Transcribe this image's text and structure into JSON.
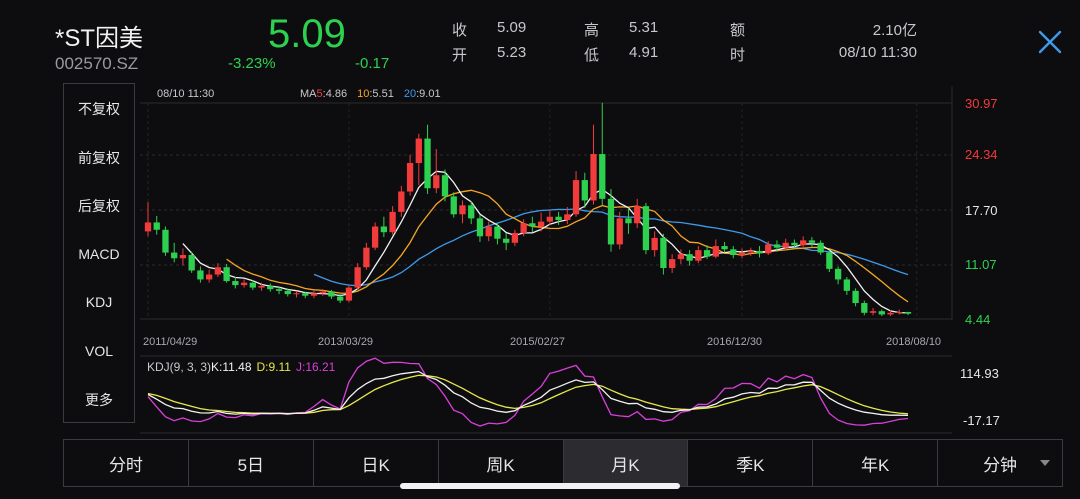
{
  "header": {
    "name": "*ST因美",
    "code": "002570.SZ",
    "price": "5.09",
    "change_pct": "-3.23%",
    "change_abs": "-0.17",
    "quotes": [
      {
        "label": "收",
        "value": "5.09"
      },
      {
        "label": "开",
        "value": "5.23"
      },
      {
        "label": "高",
        "value": "5.31"
      },
      {
        "label": "低",
        "value": "4.91"
      },
      {
        "label": "额",
        "value": "2.10亿"
      },
      {
        "label": "时",
        "value": "08/10 11:30"
      }
    ]
  },
  "side_menu": [
    {
      "label": "不复权",
      "active": false
    },
    {
      "label": "前复权",
      "active": true
    },
    {
      "label": "后复权",
      "active": false
    },
    {
      "label": "MACD",
      "active": false
    },
    {
      "label": "KDJ",
      "active": true
    },
    {
      "label": "VOL",
      "active": false
    },
    {
      "label": "更多",
      "active": false
    }
  ],
  "tabs": [
    {
      "label": "分时"
    },
    {
      "label": "5日"
    },
    {
      "label": "日K"
    },
    {
      "label": "周K"
    },
    {
      "label": "月K"
    },
    {
      "label": "季K"
    },
    {
      "label": "年K"
    },
    {
      "label": "分钟"
    }
  ],
  "active_tab": "月K",
  "colors": {
    "up": "#f23b3b",
    "down": "#2ed14f",
    "ma5": "#f2f2f2",
    "ma10": "#f5a623",
    "ma20": "#3f9ae8",
    "k": "#f2f2f2",
    "d": "#e8e84a",
    "j": "#d93fd9",
    "accent": "#3f9ae8"
  },
  "chart_data": {
    "type": "candlestick",
    "period": "monthly",
    "date_label": "08/10 11:30",
    "ma_legend": {
      "prefix": "MA",
      "ma5_label": "5",
      "ma5_value": "4.86",
      "ma10_label": "10",
      "ma10_value": "5.51",
      "ma20_label": "20",
      "ma20_value": "9.01"
    },
    "price_ticks": [
      "30.97",
      "24.34",
      "17.70",
      "11.07",
      "4.44"
    ],
    "price_tick_values": [
      30.97,
      24.34,
      17.7,
      11.07,
      4.44
    ],
    "x_ticks": [
      "2011/04/29",
      "2013/03/29",
      "2015/02/27",
      "2016/12/30",
      "2018/08/10"
    ],
    "x_tick_index": [
      0,
      23,
      46,
      68,
      88
    ],
    "candles": [
      [
        15.2,
        16.3,
        18.8,
        14.6
      ],
      [
        16.3,
        15.4,
        17.1,
        14.8
      ],
      [
        15.4,
        12.6,
        15.8,
        12.2
      ],
      [
        12.6,
        11.9,
        13.8,
        11.4
      ],
      [
        11.9,
        12.3,
        13.1,
        11.0
      ],
      [
        12.3,
        10.4,
        12.7,
        10.1
      ],
      [
        10.4,
        9.3,
        10.9,
        8.9
      ],
      [
        9.3,
        9.9,
        10.5,
        8.9
      ],
      [
        9.9,
        10.8,
        11.3,
        9.6
      ],
      [
        10.8,
        9.1,
        11.2,
        8.9
      ],
      [
        9.1,
        8.6,
        9.6,
        8.2
      ],
      [
        8.6,
        8.9,
        9.3,
        8.3
      ],
      [
        8.9,
        8.3,
        9.2,
        8.0
      ],
      [
        8.3,
        8.5,
        8.9,
        7.9
      ],
      [
        8.5,
        8.1,
        8.8,
        7.8
      ],
      [
        8.1,
        7.9,
        8.4,
        7.5
      ],
      [
        7.9,
        7.5,
        8.2,
        7.2
      ],
      [
        7.5,
        7.6,
        7.9,
        7.1
      ],
      [
        7.6,
        7.3,
        7.8,
        7.0
      ],
      [
        7.3,
        7.6,
        7.9,
        7.0
      ],
      [
        7.6,
        7.8,
        8.1,
        7.3
      ],
      [
        7.8,
        7.2,
        8.0,
        6.9
      ],
      [
        7.2,
        6.7,
        7.5,
        6.4
      ],
      [
        6.7,
        8.3,
        8.6,
        6.5
      ],
      [
        8.3,
        10.8,
        11.3,
        8.1
      ],
      [
        10.8,
        13.2,
        13.8,
        10.5
      ],
      [
        13.2,
        15.8,
        16.3,
        12.9
      ],
      [
        15.8,
        15.1,
        17.0,
        14.5
      ],
      [
        15.1,
        17.6,
        18.3,
        14.8
      ],
      [
        17.6,
        20.1,
        20.8,
        17.0
      ],
      [
        20.1,
        23.6,
        24.6,
        19.6
      ],
      [
        23.6,
        26.6,
        27.2,
        20.9
      ],
      [
        26.6,
        20.5,
        28.3,
        19.8
      ],
      [
        20.5,
        22.1,
        25.3,
        19.9
      ],
      [
        22.1,
        19.5,
        22.8,
        18.9
      ],
      [
        19.5,
        17.3,
        20.0,
        16.9
      ],
      [
        17.3,
        18.4,
        19.0,
        16.2
      ],
      [
        18.4,
        16.8,
        18.9,
        16.1
      ],
      [
        16.8,
        14.6,
        17.2,
        13.9
      ],
      [
        14.6,
        15.8,
        16.4,
        14.0
      ],
      [
        15.8,
        14.3,
        16.2,
        13.6
      ],
      [
        14.3,
        13.8,
        15.0,
        12.9
      ],
      [
        13.8,
        15.0,
        15.4,
        13.4
      ],
      [
        15.0,
        16.2,
        16.7,
        14.6
      ],
      [
        16.2,
        15.8,
        17.0,
        15.1
      ],
      [
        15.8,
        16.4,
        17.5,
        15.2
      ],
      [
        16.4,
        17.0,
        17.8,
        16.0
      ],
      [
        17.0,
        16.6,
        17.6,
        16.0
      ],
      [
        16.6,
        17.3,
        18.2,
        16.1
      ],
      [
        17.3,
        21.5,
        22.6,
        17.0
      ],
      [
        21.5,
        19.0,
        22.4,
        18.1
      ],
      [
        19.0,
        24.7,
        28.3,
        18.5
      ],
      [
        24.7,
        19.2,
        31.0,
        18.4
      ],
      [
        19.2,
        13.6,
        20.4,
        12.7
      ],
      [
        13.6,
        16.8,
        17.6,
        13.0
      ],
      [
        16.8,
        16.2,
        18.1,
        14.9
      ],
      [
        16.2,
        18.3,
        19.2,
        15.6
      ],
      [
        18.3,
        12.9,
        18.7,
        12.4
      ],
      [
        12.9,
        14.4,
        15.2,
        12.1
      ],
      [
        14.4,
        10.7,
        14.9,
        9.9
      ],
      [
        10.7,
        11.8,
        12.4,
        10.1
      ],
      [
        11.8,
        12.4,
        13.0,
        11.2
      ],
      [
        12.4,
        11.6,
        12.9,
        11.0
      ],
      [
        11.6,
        12.9,
        13.4,
        11.3
      ],
      [
        12.9,
        12.1,
        13.5,
        11.8
      ],
      [
        12.1,
        13.4,
        14.2,
        11.9
      ],
      [
        13.4,
        13.0,
        13.9,
        12.6
      ],
      [
        13.0,
        12.3,
        13.4,
        11.9
      ],
      [
        12.3,
        12.6,
        13.1,
        11.9
      ],
      [
        12.6,
        12.8,
        13.2,
        12.2
      ],
      [
        12.8,
        12.5,
        13.4,
        12.0
      ],
      [
        12.5,
        13.6,
        14.0,
        12.3
      ],
      [
        13.6,
        13.2,
        14.1,
        12.7
      ],
      [
        13.2,
        13.8,
        14.3,
        12.9
      ],
      [
        13.8,
        13.5,
        14.2,
        13.0
      ],
      [
        13.5,
        14.1,
        14.6,
        13.1
      ],
      [
        14.1,
        13.8,
        14.5,
        13.2
      ],
      [
        13.8,
        12.6,
        14.1,
        12.3
      ],
      [
        12.6,
        10.6,
        12.9,
        10.2
      ],
      [
        10.6,
        9.3,
        10.9,
        8.7
      ],
      [
        9.3,
        7.9,
        9.6,
        7.4
      ],
      [
        7.9,
        6.4,
        8.2,
        6.0
      ],
      [
        6.4,
        5.2,
        6.7,
        4.9
      ],
      [
        5.2,
        5.4,
        5.8,
        4.9
      ],
      [
        5.4,
        5.0,
        5.6,
        4.8
      ],
      [
        5.0,
        5.2,
        5.5,
        4.8
      ],
      [
        5.2,
        5.3,
        5.6,
        5.0
      ],
      [
        5.3,
        5.09,
        5.31,
        4.91
      ]
    ],
    "kdj_legend": {
      "label": "KDJ(9, 3, 3)",
      "k_label": "K:11.48",
      "d_label": "D:9.11",
      "j_label": "J:16.21"
    },
    "kdj_ticks": [
      "114.93",
      "-17.17"
    ],
    "kdj_range": [
      -17.17,
      114.93
    ]
  }
}
